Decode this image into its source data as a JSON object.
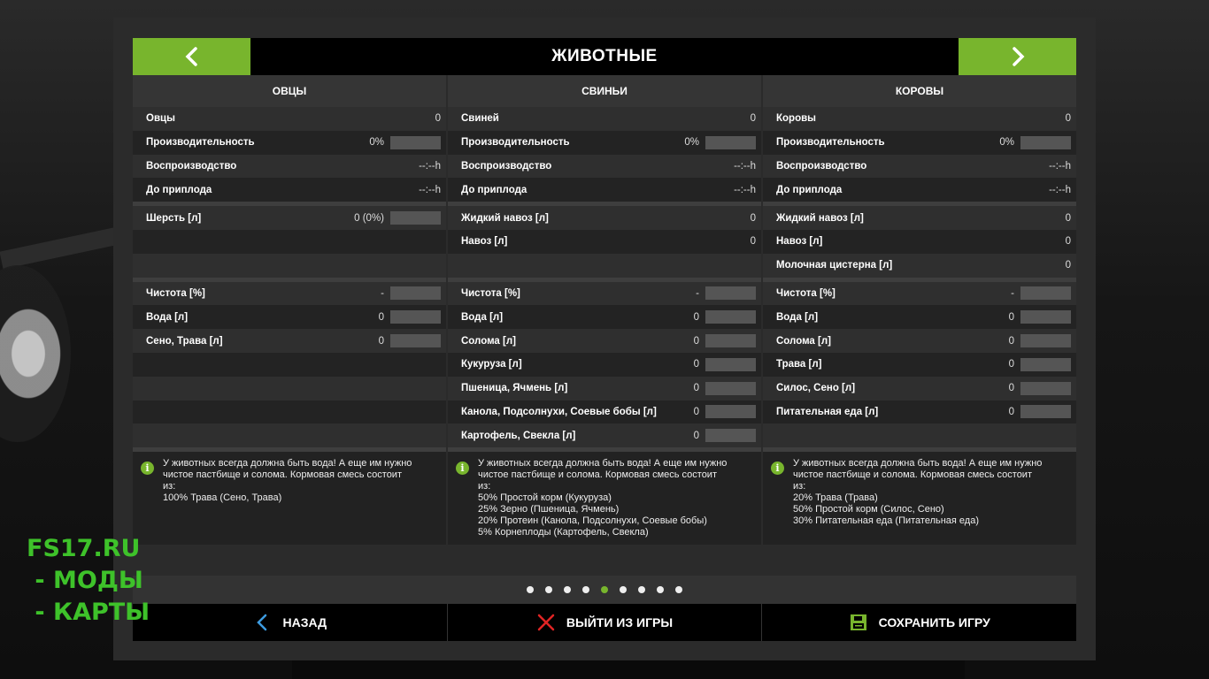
{
  "header": {
    "title": "ЖИВОТНЫЕ",
    "prev_icon": "chevron-left-icon",
    "next_icon": "chevron-right-icon"
  },
  "columns": [
    {
      "title": "ОВЦЫ",
      "stats": [
        {
          "label": "Овцы",
          "value": "0"
        },
        {
          "label": "Производительность",
          "value": "0%",
          "bar": 0
        },
        {
          "label": "Воспроизводство",
          "value": "--:--h"
        },
        {
          "label": "До приплода",
          "value": "--:--h"
        }
      ],
      "products": [
        {
          "label": "Шерсть [л]",
          "value": "0 (0%)",
          "bar": 0
        },
        {
          "label": "",
          "value": ""
        },
        {
          "label": "",
          "value": ""
        }
      ],
      "needs": [
        {
          "label": "Чистота [%]",
          "value": "-",
          "bar": 0
        },
        {
          "label": "Вода [л]",
          "value": "0",
          "bar": 0
        },
        {
          "label": "Сено, Трава [л]",
          "value": "0",
          "bar": 0
        },
        {
          "label": "",
          "value": ""
        },
        {
          "label": "",
          "value": ""
        },
        {
          "label": "",
          "value": ""
        },
        {
          "label": "",
          "value": ""
        }
      ],
      "info": "У животных всегда должна быть вода! А еще им нужно\nчистое пастбище и солома. Кормовая смесь состоит\nиз:\n100% Трава (Сено, Трава)"
    },
    {
      "title": "СВИНЬИ",
      "stats": [
        {
          "label": "Свиней",
          "value": "0"
        },
        {
          "label": "Производительность",
          "value": "0%",
          "bar": 0
        },
        {
          "label": "Воспроизводство",
          "value": "--:--h"
        },
        {
          "label": "До приплода",
          "value": "--:--h"
        }
      ],
      "products": [
        {
          "label": "Жидкий навоз [л]",
          "value": "0"
        },
        {
          "label": "Навоз [л]",
          "value": "0"
        },
        {
          "label": "",
          "value": ""
        }
      ],
      "needs": [
        {
          "label": "Чистота [%]",
          "value": "-",
          "bar": 0
        },
        {
          "label": "Вода [л]",
          "value": "0",
          "bar": 0
        },
        {
          "label": "Солома [л]",
          "value": "0",
          "bar": 0
        },
        {
          "label": "Кукуруза [л]",
          "value": "0",
          "bar": 0
        },
        {
          "label": "Пшеница, Ячмень [л]",
          "value": "0",
          "bar": 0
        },
        {
          "label": "Канола, Подсолнухи, Соевые бобы [л]",
          "value": "0",
          "bar": 0
        },
        {
          "label": "Картофель, Свекла [л]",
          "value": "0",
          "bar": 0
        }
      ],
      "info": "У животных всегда должна быть вода! А еще им нужно\nчистое пастбище и солома. Кормовая смесь состоит\nиз:\n50% Простой корм (Кукуруза)\n25% Зерно (Пшеница, Ячмень)\n20% Протеин (Канола, Подсолнухи, Соевые бобы)\n5% Корнеплоды (Картофель, Свекла)"
    },
    {
      "title": "КОРОВЫ",
      "stats": [
        {
          "label": "Коровы",
          "value": "0"
        },
        {
          "label": "Производительность",
          "value": "0%",
          "bar": 0
        },
        {
          "label": "Воспроизводство",
          "value": "--:--h"
        },
        {
          "label": "До приплода",
          "value": "--:--h"
        }
      ],
      "products": [
        {
          "label": "Жидкий навоз [л]",
          "value": "0"
        },
        {
          "label": "Навоз [л]",
          "value": "0"
        },
        {
          "label": "Молочная цистерна [л]",
          "value": "0"
        }
      ],
      "needs": [
        {
          "label": "Чистота [%]",
          "value": "-",
          "bar": 0
        },
        {
          "label": "Вода [л]",
          "value": "0",
          "bar": 0
        },
        {
          "label": "Солома [л]",
          "value": "0",
          "bar": 0
        },
        {
          "label": "Трава [л]",
          "value": "0",
          "bar": 0
        },
        {
          "label": "Силос, Сено [л]",
          "value": "0",
          "bar": 0
        },
        {
          "label": "Питательная еда [л]",
          "value": "0",
          "bar": 0
        },
        {
          "label": "",
          "value": ""
        }
      ],
      "info": "У животных всегда должна быть вода! А еще им нужно\nчистое пастбище и солома. Кормовая смесь состоит\nиз:\n20% Трава (Трава)\n50% Простой корм (Силос, Сено)\n30% Питательная еда (Питательная еда)"
    }
  ],
  "pager": {
    "count": 9,
    "active_index": 4
  },
  "footer": {
    "back_label": "НАЗАД",
    "back_icon": "back-chevron-icon",
    "quit_label": "ВЫЙТИ ИЗ ИГРЫ",
    "quit_icon": "close-x-icon",
    "save_label": "СОХРАНИТЬ ИГРУ",
    "save_icon": "floppy-disk-icon"
  },
  "watermark": {
    "line1": "FS17.RU",
    "line2": " - МОДЫ",
    "line3": " - КАРТЫ"
  },
  "colors": {
    "accent": "#78b52d",
    "watermark": "#3ec22a"
  }
}
